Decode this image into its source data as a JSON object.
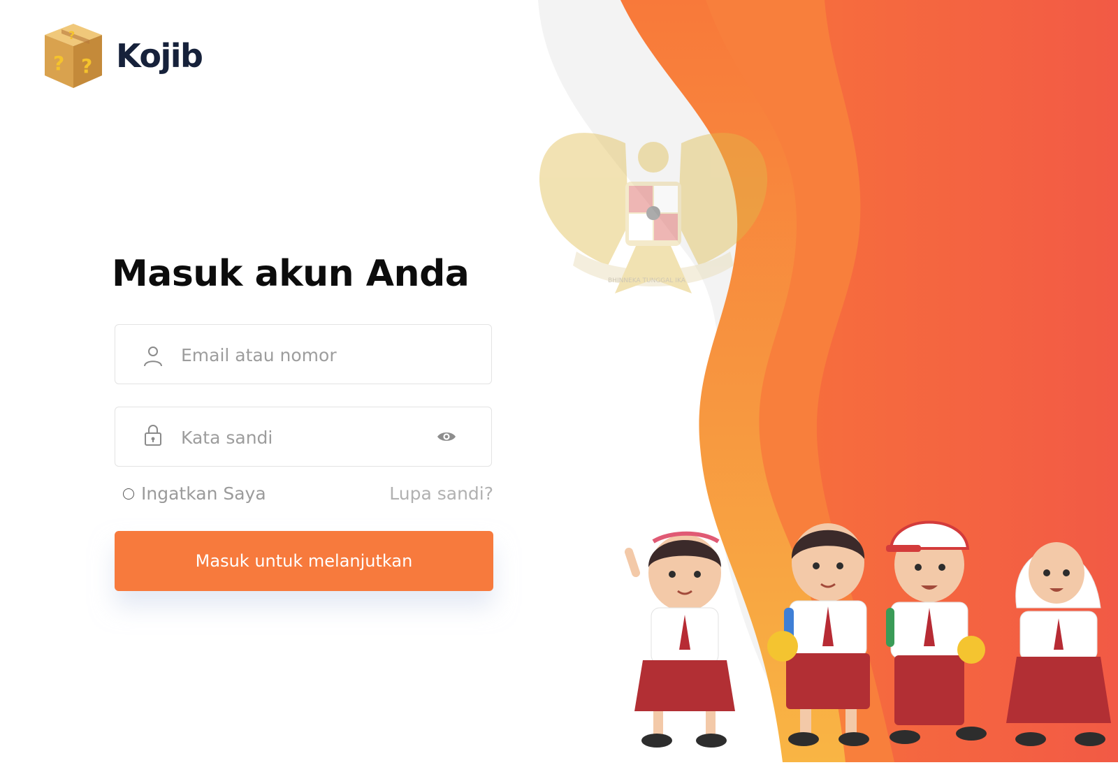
{
  "brand": {
    "name": "Kojib"
  },
  "login": {
    "title": "Masuk akun Anda",
    "email_placeholder": "Email atau nomor",
    "password_placeholder": "Kata sandi",
    "remember_label": "Ingatkan Saya",
    "forgot_label": "Lupa sandi?",
    "submit_label": "Masuk untuk melanjutkan"
  },
  "emblem_text": "BHINNEKA TUNGGAL IKA",
  "colors": {
    "accent": "#f77a3d",
    "brand_text": "#16213a",
    "wave_dark": "#f25a45",
    "wave_light": "#f9b544"
  },
  "icons": [
    "logo-box-icon",
    "user-icon",
    "lock-icon",
    "eye-icon",
    "garuda-emblem",
    "students-illustration"
  ]
}
